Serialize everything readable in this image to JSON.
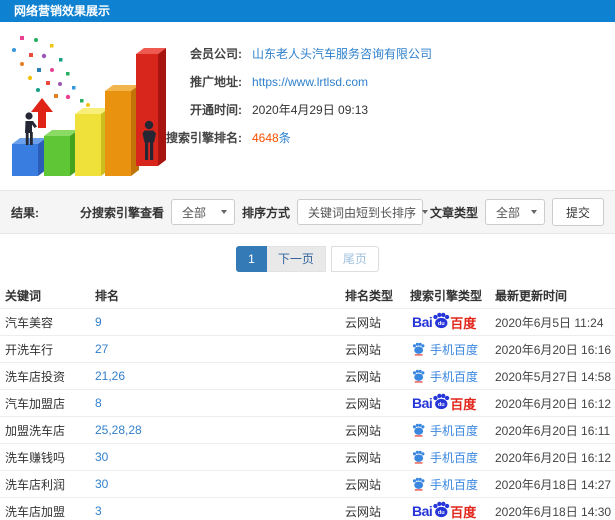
{
  "colors": {
    "header_blue": "#0e81d1",
    "link_blue": "#2f80cd",
    "rank_link_blue": "#3380cc",
    "count_red": "#f85000",
    "baidu_blue": "#2636d9",
    "baidu_red": "#e1251b",
    "pagination_active_blue": "#337ab7",
    "filter_bar_gray": "#f5f5f5"
  },
  "header": {
    "title": "网络营销效果展示"
  },
  "company": {
    "member_label": "会员公司:",
    "member_value": "山东老人头汽车服务咨询有限公司",
    "url_label": "推广地址:",
    "url_value": "https://www.lrtlsd.com",
    "open_label": "开通时间:",
    "open_value": "2020年4月29日 09:13",
    "rank_label": "搜索引擎排名:",
    "rank_count": "4648",
    "rank_unit": "条"
  },
  "filters": {
    "result_label": "结果:",
    "engine_view_label": "分搜索引擎查看",
    "engine_view_value": "全部",
    "sort_label": "排序方式",
    "sort_value": "关键词由短到长排序",
    "article_type_label": "文章类型",
    "article_type_value": "全部",
    "submit_label": "提交"
  },
  "pagination": {
    "current": "1",
    "next": "下一页",
    "last": "尾页"
  },
  "logos": {
    "bai": "Bai",
    "du": "du",
    "baidu_cn": "百度",
    "mobile_baidu": "手机百度"
  },
  "table": {
    "headers": [
      "关键词",
      "排名",
      "排名类型",
      "搜索引擎类型",
      "最新更新时间"
    ],
    "rows": [
      {
        "keyword": "汽车美容",
        "rank": "9",
        "rank_type": "云网站",
        "engine": "baidu",
        "updated": "2020年6月5日 11:24"
      },
      {
        "keyword": "开洗车行",
        "rank": "27",
        "rank_type": "云网站",
        "engine": "mobile",
        "updated": "2020年6月20日 16:16"
      },
      {
        "keyword": "洗车店投资",
        "rank": "21,26",
        "rank_type": "云网站",
        "engine": "mobile",
        "updated": "2020年5月27日 14:58"
      },
      {
        "keyword": "汽车加盟店",
        "rank": "8",
        "rank_type": "云网站",
        "engine": "baidu",
        "updated": "2020年6月20日 16:12"
      },
      {
        "keyword": "加盟洗车店",
        "rank": "25,28,28",
        "rank_type": "云网站",
        "engine": "mobile",
        "updated": "2020年6月20日 16:11"
      },
      {
        "keyword": "洗车赚钱吗",
        "rank": "30",
        "rank_type": "云网站",
        "engine": "mobile",
        "updated": "2020年6月20日 16:12"
      },
      {
        "keyword": "洗车店利润",
        "rank": "30",
        "rank_type": "云网站",
        "engine": "mobile",
        "updated": "2020年6月18日 14:27"
      },
      {
        "keyword": "洗车店加盟",
        "rank": "3",
        "rank_type": "云网站",
        "engine": "baidu",
        "updated": "2020年6月18日 14:30"
      }
    ]
  }
}
